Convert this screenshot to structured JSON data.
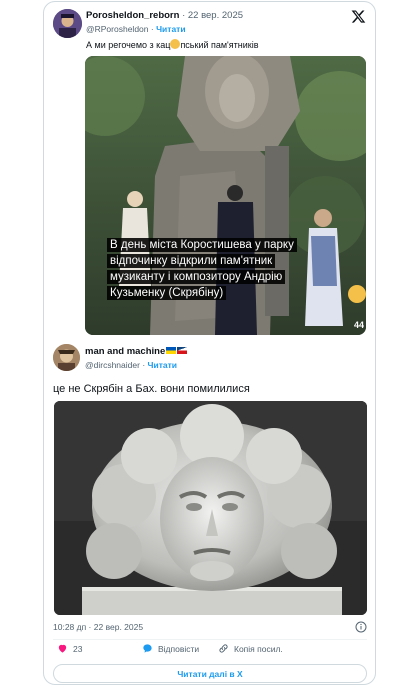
{
  "tweet": {
    "display_name": "Porosheldon_reborn",
    "date": "· 22 вер. 2025",
    "handle": "@RPorosheldon",
    "follow_label": "Читати",
    "text_before_emoji": "А ми регочемо з кац",
    "text_after_emoji": "пський пам'ятників",
    "video_caption": "В день міста Коростишева у парку відпочинку відкрили пам'ятник музиканту і композитору Андрію Кузьменку (Скрябіну)",
    "reaction_count": "44"
  },
  "quote": {
    "display_name": "man and machine",
    "handle": "@dircshnaider",
    "follow_label": "Читати",
    "text": "це не Скрябін а Бах. вони помилилися"
  },
  "footer": {
    "timestamp": "10:28 дп · 22 вер. 2025",
    "like_count": "23",
    "reply_label": "Відповісти",
    "copy_link_label": "Копія посил.",
    "read_more_label": "Читати далі в X"
  },
  "colors": {
    "accent": "#1d9bf0",
    "like_red": "#f91880",
    "muted": "#536471",
    "border": "#cfd9de"
  }
}
